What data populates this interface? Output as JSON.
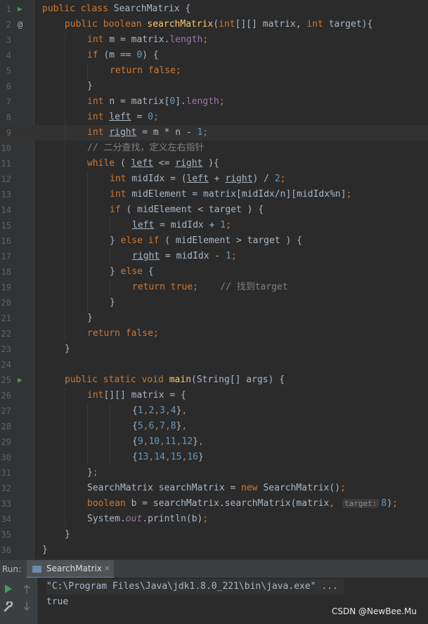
{
  "colors": {
    "editor_bg": "#2b2b2b",
    "gutter_bg": "#313335",
    "keyword": "#cc7832",
    "method": "#ffc66d",
    "number": "#6897bb",
    "field": "#9876aa",
    "comment": "#808080",
    "text": "#a9b7c6",
    "run_icon": "#499c54"
  },
  "code_lines": [
    {
      "n": "1",
      "icon": "run",
      "indent": 0,
      "tokens": [
        [
          "kw",
          "public class "
        ],
        [
          "t",
          "SearchMatrix {"
        ]
      ]
    },
    {
      "n": "2",
      "icon": "at",
      "indent": 1,
      "tokens": [
        [
          "kw",
          "public boolean "
        ],
        [
          "fn",
          "searchMatrix"
        ],
        [
          "t",
          "("
        ],
        [
          "kw",
          "int"
        ],
        [
          "t",
          "[][] matrix, "
        ],
        [
          "kw",
          "int "
        ],
        [
          "t",
          "target){"
        ]
      ]
    },
    {
      "n": "3",
      "indent": 2,
      "tokens": [
        [
          "kw",
          "int "
        ],
        [
          "t",
          "m = matrix."
        ],
        [
          "fld",
          "length"
        ],
        [
          "kw",
          ";"
        ]
      ]
    },
    {
      "n": "4",
      "indent": 2,
      "tokens": [
        [
          "kw",
          "if "
        ],
        [
          "t",
          "(m == "
        ],
        [
          "num",
          "0"
        ],
        [
          "t",
          ") {"
        ]
      ]
    },
    {
      "n": "5",
      "indent": 3,
      "tokens": [
        [
          "kw",
          "return false;"
        ]
      ]
    },
    {
      "n": "6",
      "indent": 2,
      "tokens": [
        [
          "t",
          "}"
        ]
      ]
    },
    {
      "n": "7",
      "indent": 2,
      "tokens": [
        [
          "kw",
          "int "
        ],
        [
          "t",
          "n = matrix["
        ],
        [
          "num",
          "0"
        ],
        [
          "t",
          "]."
        ],
        [
          "fld",
          "length"
        ],
        [
          "kw",
          ";"
        ]
      ]
    },
    {
      "n": "8",
      "indent": 2,
      "tokens": [
        [
          "kw",
          "int "
        ],
        [
          "ul",
          "left"
        ],
        [
          "t",
          " = "
        ],
        [
          "num",
          "0"
        ],
        [
          "kw",
          ";"
        ]
      ]
    },
    {
      "n": "9",
      "indent": 2,
      "current": true,
      "tokens": [
        [
          "kw",
          "int "
        ],
        [
          "ul",
          "right"
        ],
        [
          "t",
          " = m * n - "
        ],
        [
          "num",
          "1"
        ],
        [
          "kw",
          ";"
        ]
      ]
    },
    {
      "n": "10",
      "indent": 2,
      "tokens": [
        [
          "cmt",
          "// 二分查找，定义左右指针"
        ]
      ]
    },
    {
      "n": "11",
      "indent": 2,
      "tokens": [
        [
          "kw",
          "while "
        ],
        [
          "t",
          "( "
        ],
        [
          "ul",
          "left"
        ],
        [
          "t",
          " <= "
        ],
        [
          "ul",
          "right"
        ],
        [
          "t",
          " ){"
        ]
      ]
    },
    {
      "n": "12",
      "indent": 3,
      "tokens": [
        [
          "kw",
          "int "
        ],
        [
          "t",
          "midIdx = ("
        ],
        [
          "ul",
          "left"
        ],
        [
          "t",
          " + "
        ],
        [
          "ul",
          "right"
        ],
        [
          "t",
          ") / "
        ],
        [
          "num",
          "2"
        ],
        [
          "kw",
          ";"
        ]
      ]
    },
    {
      "n": "13",
      "indent": 3,
      "tokens": [
        [
          "kw",
          "int "
        ],
        [
          "t",
          "midElement = matrix[midIdx/n][midIdx%n]"
        ],
        [
          "kw",
          ";"
        ]
      ]
    },
    {
      "n": "14",
      "indent": 3,
      "tokens": [
        [
          "kw",
          "if "
        ],
        [
          "t",
          "( midElement < target ) {"
        ]
      ]
    },
    {
      "n": "15",
      "indent": 4,
      "tokens": [
        [
          "ul",
          "left"
        ],
        [
          "t",
          " = midIdx + "
        ],
        [
          "num",
          "1"
        ],
        [
          "kw",
          ";"
        ]
      ]
    },
    {
      "n": "16",
      "indent": 3,
      "tokens": [
        [
          "t",
          "} "
        ],
        [
          "kw",
          "else if "
        ],
        [
          "t",
          "( midElement > target ) {"
        ]
      ]
    },
    {
      "n": "17",
      "indent": 4,
      "tokens": [
        [
          "ul",
          "right"
        ],
        [
          "t",
          " = midIdx - "
        ],
        [
          "num",
          "1"
        ],
        [
          "kw",
          ";"
        ]
      ]
    },
    {
      "n": "18",
      "indent": 3,
      "tokens": [
        [
          "t",
          "} "
        ],
        [
          "kw",
          "else "
        ],
        [
          "t",
          "{"
        ]
      ]
    },
    {
      "n": "19",
      "indent": 4,
      "tokens": [
        [
          "kw",
          "return true;"
        ],
        [
          "t",
          "    "
        ],
        [
          "cmt",
          "// 找到target"
        ]
      ]
    },
    {
      "n": "20",
      "indent": 3,
      "tokens": [
        [
          "t",
          "}"
        ]
      ]
    },
    {
      "n": "21",
      "indent": 2,
      "tokens": [
        [
          "t",
          "}"
        ]
      ]
    },
    {
      "n": "22",
      "indent": 2,
      "tokens": [
        [
          "kw",
          "return false;"
        ]
      ]
    },
    {
      "n": "23",
      "indent": 1,
      "tokens": [
        [
          "t",
          "}"
        ]
      ]
    },
    {
      "n": "24",
      "indent": 0,
      "tokens": []
    },
    {
      "n": "25",
      "icon": "run",
      "indent": 1,
      "tokens": [
        [
          "kw",
          "public static void "
        ],
        [
          "fn",
          "main"
        ],
        [
          "t",
          "(String[] args) {"
        ]
      ]
    },
    {
      "n": "26",
      "indent": 2,
      "tokens": [
        [
          "kw",
          "int"
        ],
        [
          "t",
          "[][] matrix = {"
        ]
      ]
    },
    {
      "n": "27",
      "indent": 4,
      "tokens": [
        [
          "t",
          "{"
        ],
        [
          "num",
          "1"
        ],
        [
          "kw",
          ","
        ],
        [
          "num",
          "2"
        ],
        [
          "kw",
          ","
        ],
        [
          "num",
          "3"
        ],
        [
          "kw",
          ","
        ],
        [
          "num",
          "4"
        ],
        [
          "t",
          "}"
        ],
        [
          "kw",
          ","
        ]
      ]
    },
    {
      "n": "28",
      "indent": 4,
      "tokens": [
        [
          "t",
          "{"
        ],
        [
          "num",
          "5"
        ],
        [
          "kw",
          ","
        ],
        [
          "num",
          "6"
        ],
        [
          "kw",
          ","
        ],
        [
          "num",
          "7"
        ],
        [
          "kw",
          ","
        ],
        [
          "num",
          "8"
        ],
        [
          "t",
          "}"
        ],
        [
          "kw",
          ","
        ]
      ]
    },
    {
      "n": "29",
      "indent": 4,
      "tokens": [
        [
          "t",
          "{"
        ],
        [
          "num",
          "9"
        ],
        [
          "kw",
          ","
        ],
        [
          "num",
          "10"
        ],
        [
          "kw",
          ","
        ],
        [
          "num",
          "11"
        ],
        [
          "kw",
          ","
        ],
        [
          "num",
          "12"
        ],
        [
          "t",
          "}"
        ],
        [
          "kw",
          ","
        ]
      ]
    },
    {
      "n": "30",
      "indent": 4,
      "tokens": [
        [
          "t",
          "{"
        ],
        [
          "num",
          "13"
        ],
        [
          "kw",
          ","
        ],
        [
          "num",
          "14"
        ],
        [
          "kw",
          ","
        ],
        [
          "num",
          "15"
        ],
        [
          "kw",
          ","
        ],
        [
          "num",
          "16"
        ],
        [
          "t",
          "}"
        ]
      ]
    },
    {
      "n": "31",
      "indent": 2,
      "tokens": [
        [
          "t",
          "}"
        ],
        [
          "kw",
          ";"
        ]
      ]
    },
    {
      "n": "32",
      "indent": 2,
      "tokens": [
        [
          "t",
          "SearchMatrix searchMatrix = "
        ],
        [
          "kw",
          "new "
        ],
        [
          "t",
          "SearchMatrix()"
        ],
        [
          "kw",
          ";"
        ]
      ]
    },
    {
      "n": "33",
      "indent": 2,
      "tokens": [
        [
          "kw",
          "boolean "
        ],
        [
          "t",
          "b = searchMatrix.searchMatrix(matrix"
        ],
        [
          "kw",
          ", "
        ],
        [
          "hint",
          "target:"
        ],
        [
          "num",
          "8"
        ],
        [
          "t",
          ")"
        ],
        [
          "kw",
          ";"
        ]
      ]
    },
    {
      "n": "34",
      "indent": 2,
      "tokens": [
        [
          "t",
          "System."
        ],
        [
          "sfld",
          "out"
        ],
        [
          "t",
          ".println(b)"
        ],
        [
          "kw",
          ";"
        ]
      ]
    },
    {
      "n": "35",
      "indent": 1,
      "tokens": [
        [
          "t",
          "}"
        ]
      ]
    },
    {
      "n": "36",
      "indent": 0,
      "tokens": [
        [
          "t",
          "}"
        ]
      ]
    }
  ],
  "run_panel": {
    "label": "Run:",
    "tab_label": "SearchMatrix",
    "tab_close": "×",
    "command": "\"C:\\Program Files\\Java\\jdk1.8.0_221\\bin\\java.exe\" ...",
    "output": "true"
  },
  "watermark": "CSDN @NewBee.Mu"
}
